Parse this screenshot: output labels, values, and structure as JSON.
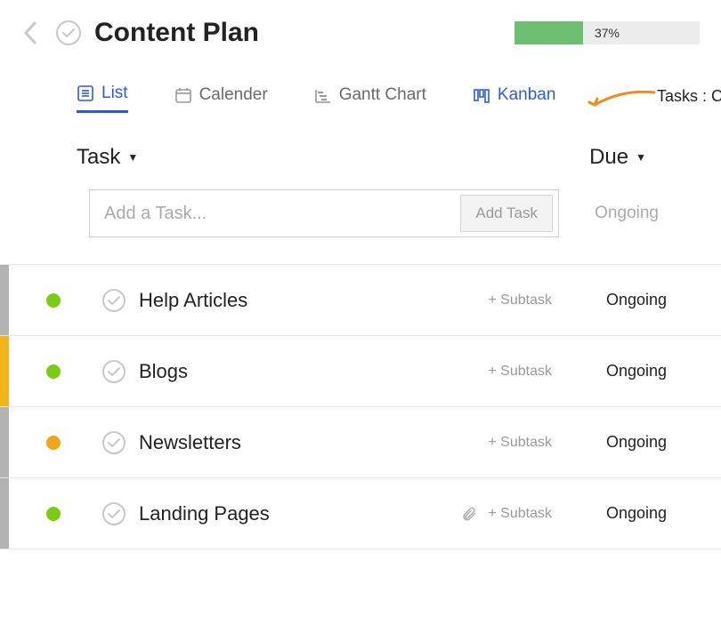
{
  "header": {
    "title": "Content Plan",
    "progress_percent": 37,
    "progress_label": "37%"
  },
  "tabs": {
    "list": "List",
    "calendar": "Calender",
    "gantt": "Gantt Chart",
    "kanban": "Kanban",
    "tasks_label": "Tasks :  C"
  },
  "columns": {
    "task": "Task",
    "due": "Due"
  },
  "add": {
    "placeholder": "Add a Task...",
    "button": "Add Task",
    "due": "Ongoing"
  },
  "tasks": [
    {
      "title": "Help Articles",
      "subtask": "+ Subtask",
      "due": "Ongoing",
      "dot": "green",
      "stripe": "gray",
      "attach": false
    },
    {
      "title": "Blogs",
      "subtask": "+ Subtask",
      "due": "Ongoing",
      "dot": "green",
      "stripe": "yellow",
      "attach": false
    },
    {
      "title": "Newsletters",
      "subtask": "+ Subtask",
      "due": "Ongoing",
      "dot": "orange",
      "stripe": "gray",
      "attach": false
    },
    {
      "title": "Landing Pages",
      "subtask": "+ Subtask",
      "due": "Ongoing",
      "dot": "green",
      "stripe": "gray",
      "attach": true
    }
  ]
}
